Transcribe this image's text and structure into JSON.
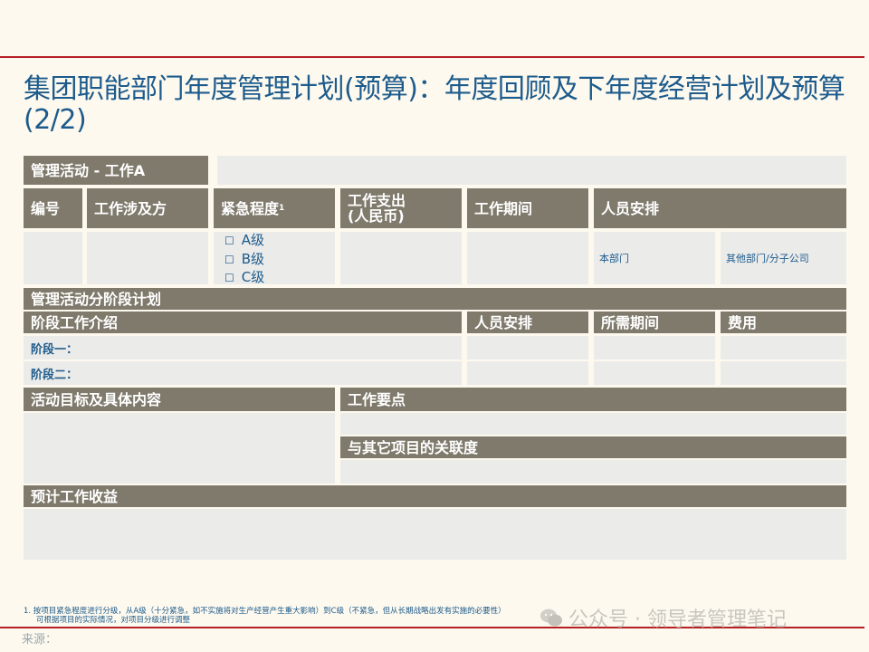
{
  "title": "集团职能部门年度管理计划(预算)：年度回顾及下年度经营计划及预算(2/2)",
  "activity_header": "管理活动 - 工作A",
  "columns": {
    "number": "编号",
    "party": "工作涉及方",
    "urgency": "紧急程度",
    "urgency_sup": "1",
    "expense_line1": "工作支出",
    "expense_line2": "(人民币)",
    "period": "工作期间",
    "staffing": "人员安排"
  },
  "urgency_levels": [
    "A级",
    "B级",
    "C级"
  ],
  "staffing_sub": {
    "own_dept": "本部门",
    "other_dept": "其他部门/分子公司"
  },
  "stage_plan": {
    "header": "管理活动分阶段计划",
    "intro": "阶段工作介绍",
    "staffing": "人员安排",
    "period_needed": "所需期间",
    "cost": "费用",
    "stage1": "阶段一：",
    "stage2": "阶段二："
  },
  "goals": {
    "header": "活动目标及具体内容",
    "key_points": "工作要点",
    "relevance": "与其它项目的关联度",
    "benefit": "预计工作收益"
  },
  "footnote_line1": "1. 按项目紧急程度进行分级，从A级（十分紧急，如不实施将对生产经营产生重大影响）到C级（不紧急，但从长期战略出发有实施的必要性）",
  "footnote_line2": "可根据项目的实际情况，对项目分级进行调整",
  "source": "来源：",
  "watermark": "公众号 · 领导者管理笔记"
}
